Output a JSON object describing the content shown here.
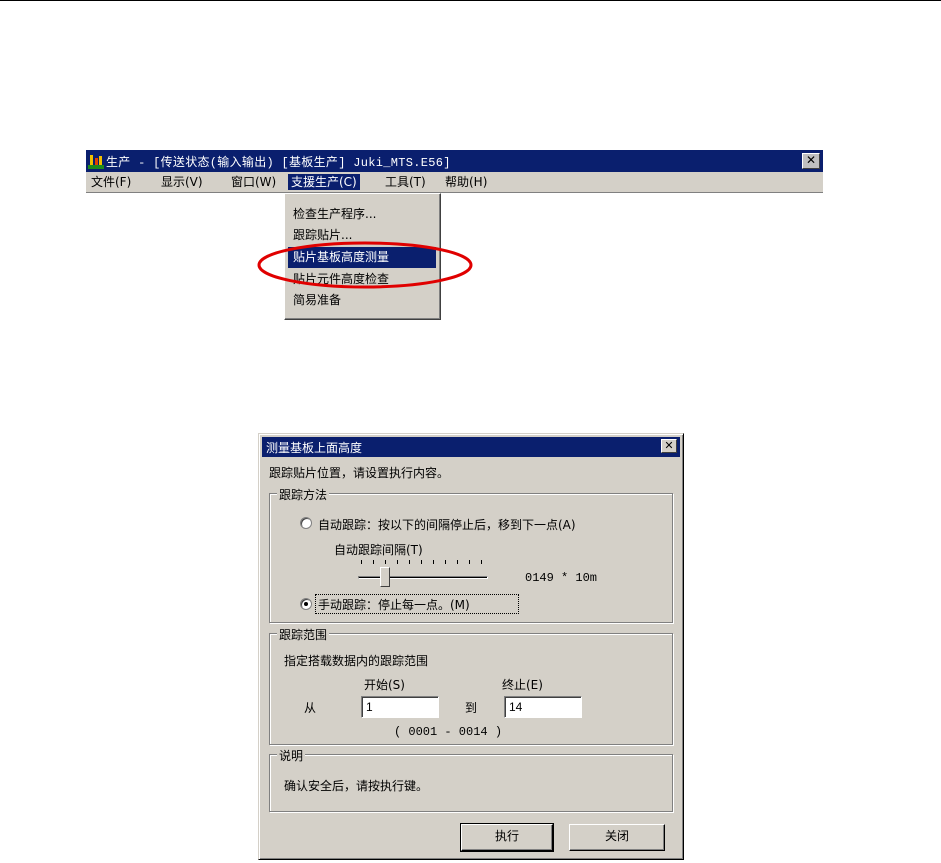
{
  "app": {
    "title": "生产 - [传送状态(输入输出) [基板生产] Juki_MTS.E56]",
    "close_glyph": "✕",
    "menu": [
      {
        "label": "文件(F)"
      },
      {
        "label": "显示(V)"
      },
      {
        "label": "窗口(W)"
      },
      {
        "label": "支援生产(C)"
      },
      {
        "label": "工具(T)"
      },
      {
        "label": "帮助(H)"
      }
    ],
    "dropdown_items": [
      {
        "label": "检查生产程序..."
      },
      {
        "label": "跟踪贴片..."
      },
      {
        "label": "贴片基板高度测量"
      },
      {
        "label": "贴片元件高度检查"
      },
      {
        "label": "简易准备"
      }
    ],
    "colors": {
      "highlight_ring": "#e00000",
      "titlebar": "#0a1f6e"
    }
  },
  "dialog": {
    "title": "测量基板上面高度",
    "close_glyph": "✕",
    "intro": "跟踪贴片位置，请设置执行内容。",
    "method": {
      "label": "跟踪方法",
      "auto_label": "自动跟踪：按以下的间隔停止后，移到下一点(A)",
      "interval_label": "自动跟踪间隔(T)",
      "interval_value": "0149 * 10m",
      "slider_level": 0.18,
      "manual_label": "手动跟踪：停止每一点。(M)",
      "selected": "manual"
    },
    "range": {
      "label": "跟踪范围",
      "desc": "指定搭载数据内的跟踪范围",
      "from_label": "从",
      "start_label": "开始(S)",
      "to_label": "到",
      "end_label": "终止(E)",
      "start_value": "1",
      "end_value": "14",
      "range_hint": "( 0001 - 0014 )"
    },
    "notes": {
      "label": "说明",
      "text": "确认安全后，请按执行键。"
    },
    "buttons": {
      "execute": "执行",
      "close": "关闭"
    }
  }
}
